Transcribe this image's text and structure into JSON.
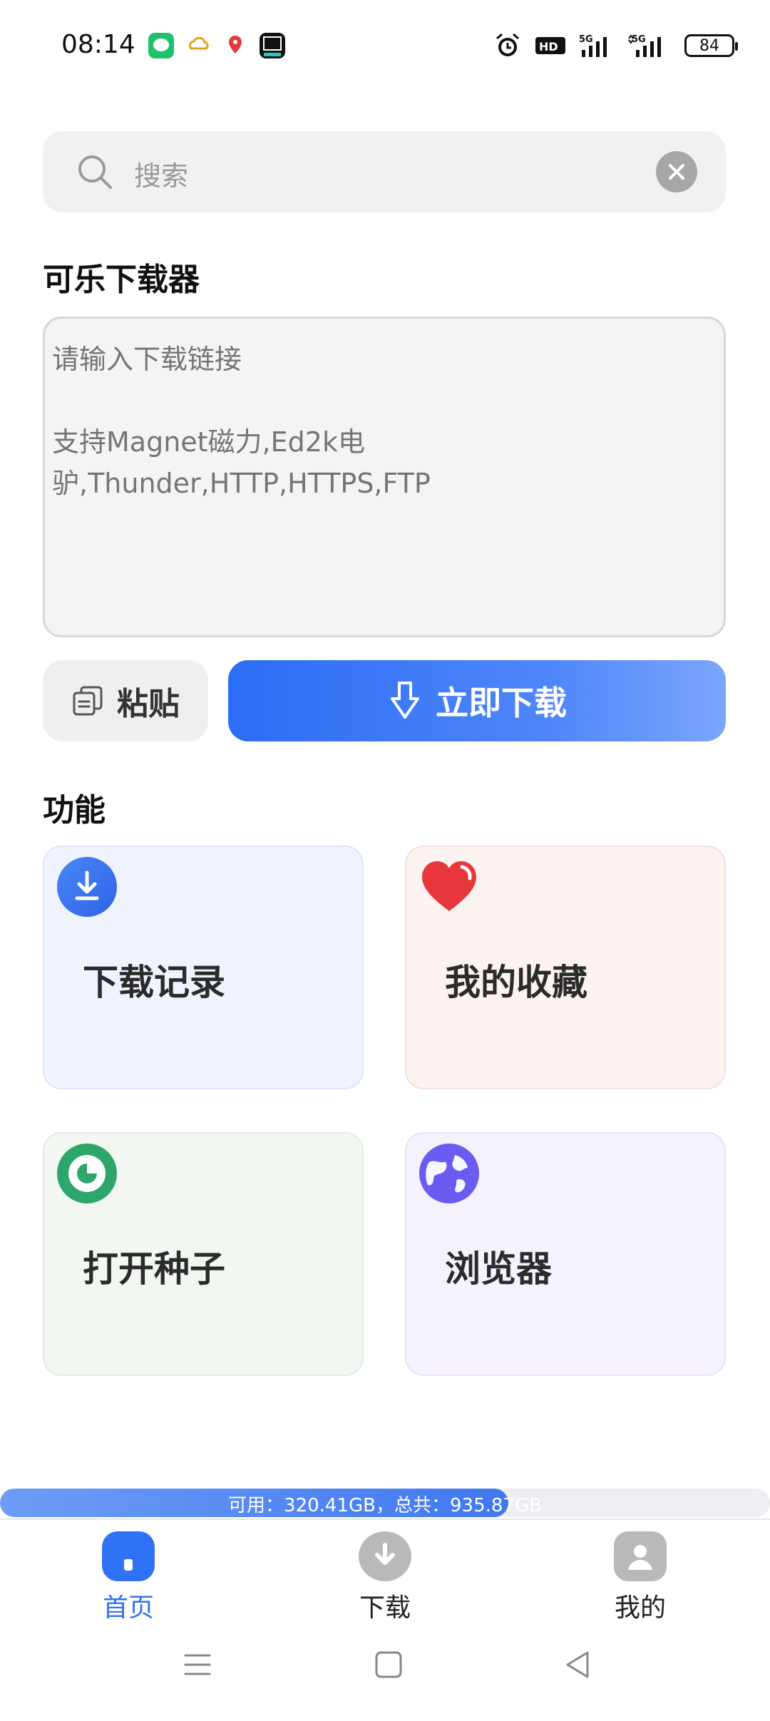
{
  "status_bar": {
    "time": "08:14",
    "battery": "84",
    "network": "HD 5G 5G"
  },
  "search": {
    "placeholder": "搜索"
  },
  "downloader": {
    "title": "可乐下载器",
    "input_placeholder": "请输入下载链接\n\n支持Magnet磁力,Ed2k电驴,Thunder,HTTP,HTTPS,FTP",
    "paste_label": "粘贴",
    "download_label": "立即下载"
  },
  "features": {
    "title": "功能",
    "items": [
      {
        "label": "下载记录",
        "icon": "download-icon",
        "bg": "#eef3fd",
        "border": "#dde6f8"
      },
      {
        "label": "我的收藏",
        "icon": "heart-icon",
        "bg": "#fcf2ef",
        "border": "#f4e1dc"
      },
      {
        "label": "打开种子",
        "icon": "seed-icon",
        "bg": "#f2f7f2",
        "border": "#e0ebe1"
      },
      {
        "label": "浏览器",
        "icon": "globe-icon",
        "bg": "#f5f1fd",
        "border": "#e8e1f8"
      }
    ]
  },
  "storage": {
    "text": "可用：320.41GB，总共：935.87GB",
    "used_fraction": 0.66
  },
  "bottom_nav": {
    "items": [
      {
        "label": "首页",
        "icon": "home-icon",
        "active": true
      },
      {
        "label": "下载",
        "icon": "download-circle-icon",
        "active": false
      },
      {
        "label": "我的",
        "icon": "user-icon",
        "active": false
      }
    ]
  },
  "colors": {
    "accent": "#2f72f5",
    "inactive_icon": "#b9b9b9"
  }
}
